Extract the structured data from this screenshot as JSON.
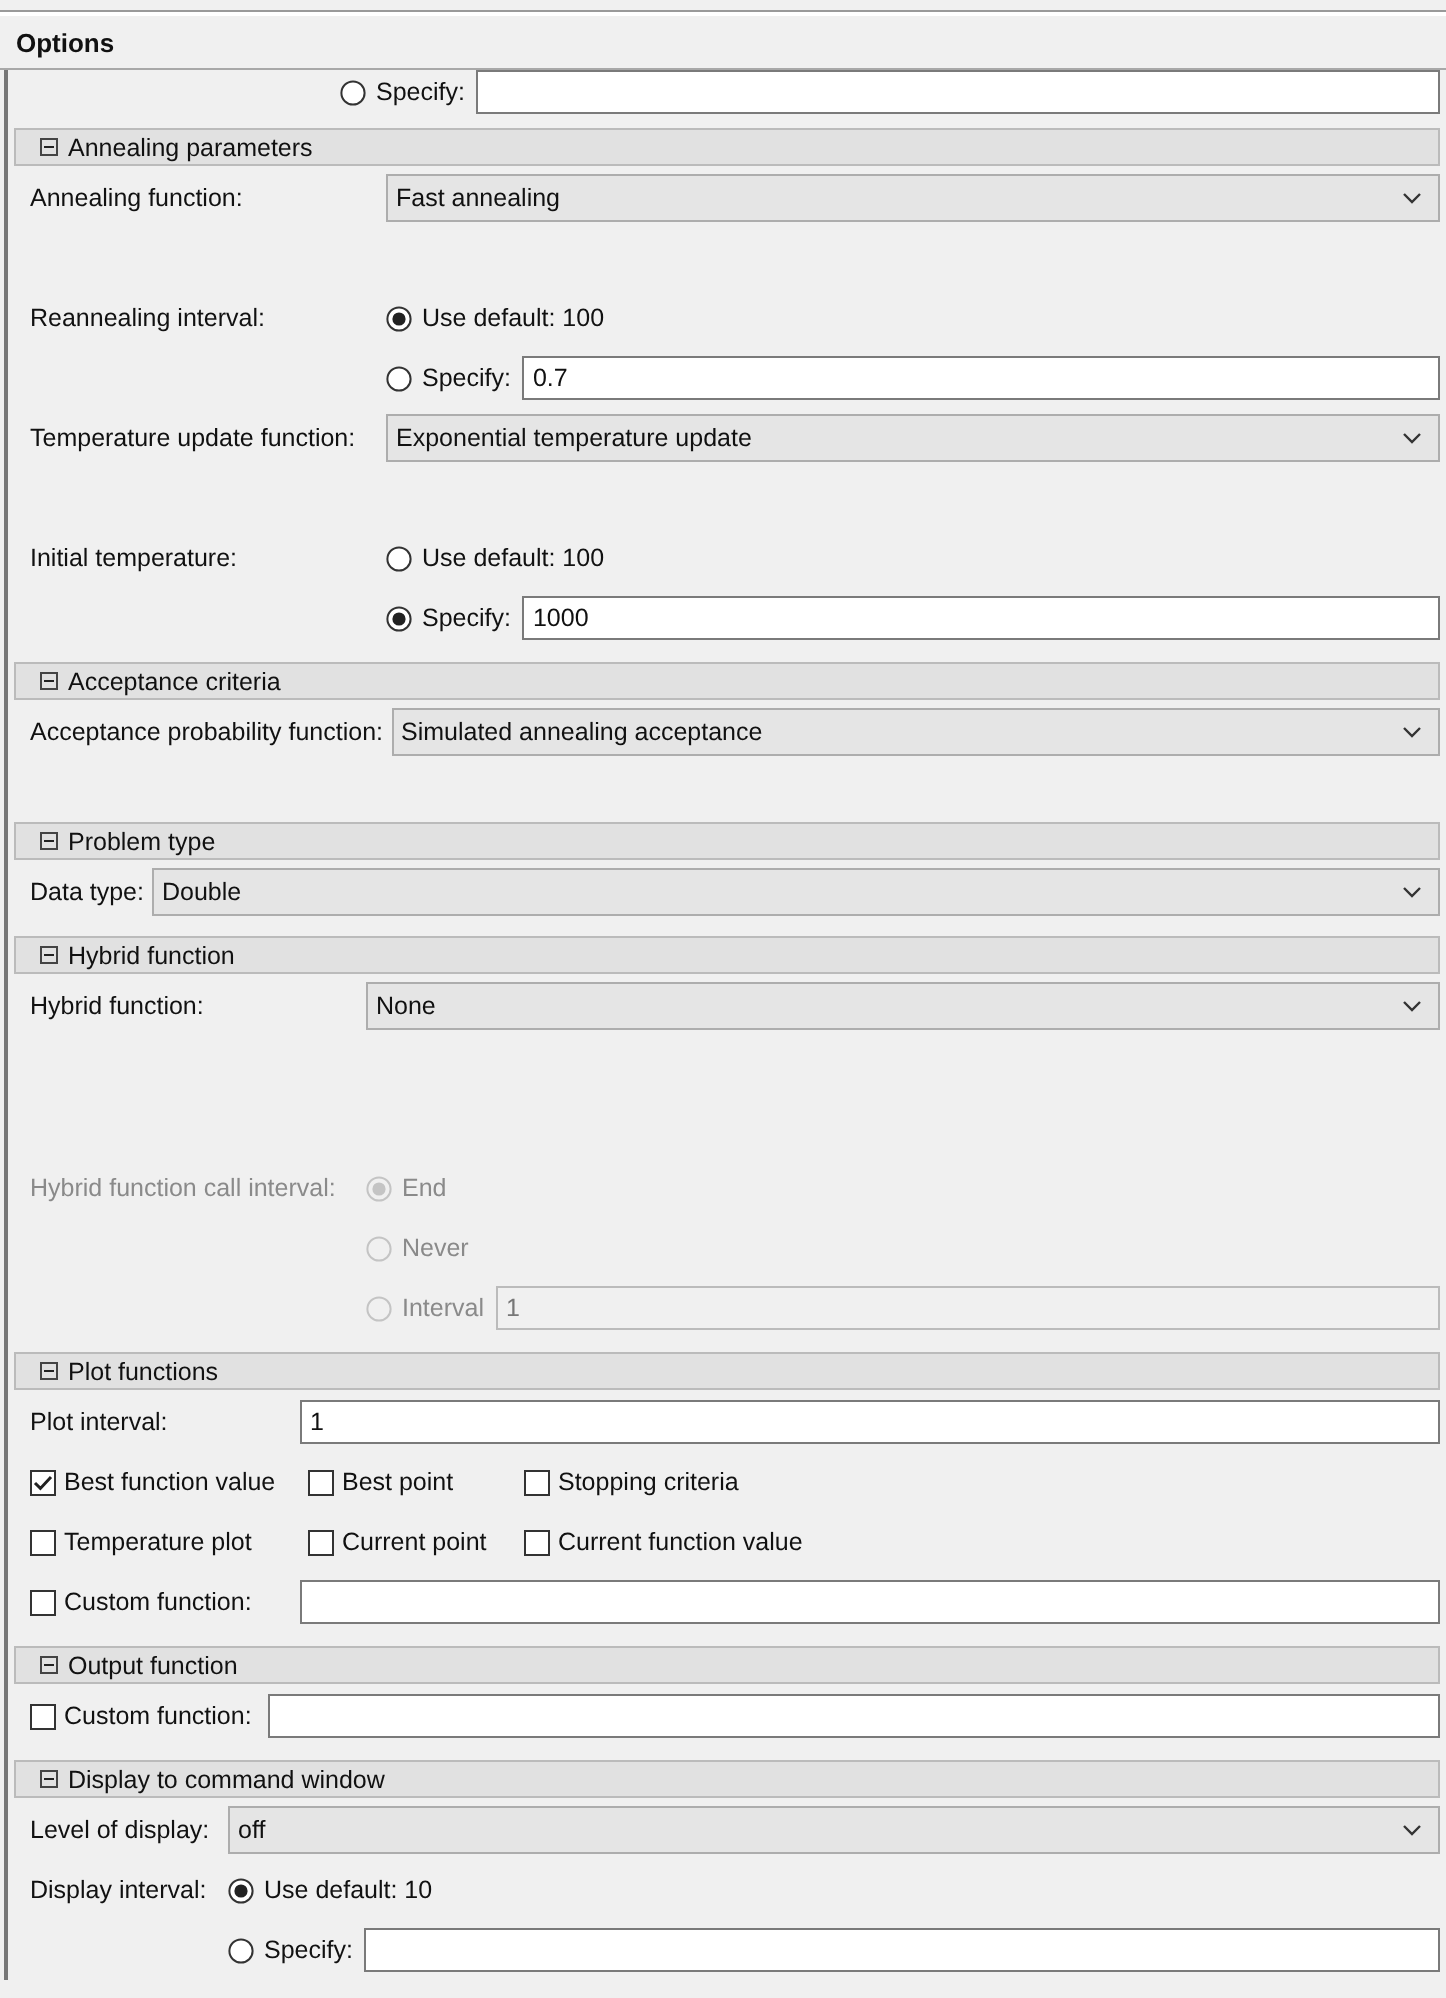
{
  "panel_title": "Options",
  "top_row": {
    "kind": "radio",
    "option": "Specify:",
    "selected": false,
    "disabled": false,
    "field": true
  },
  "sections": [
    {
      "title": "Annealing parameters",
      "expanded": true,
      "rows": [
        {
          "kind": "dropdown",
          "label": "Annealing function:",
          "value": "Fast annealing"
        },
        {
          "kind": "radio",
          "label": "Reannealing interval:",
          "option": "Use default: 100",
          "selected": true,
          "disabled": false
        },
        {
          "kind": "radio",
          "option": "Specify:",
          "selected": false,
          "disabled": false,
          "field": true,
          "value": "0.7"
        },
        {
          "kind": "dropdown",
          "label": "Temperature update function:",
          "value": "Exponential temperature update"
        },
        {
          "kind": "radio",
          "label": "Initial temperature:",
          "option": "Use default: 100",
          "selected": false,
          "disabled": false
        },
        {
          "kind": "radio",
          "option": "Specify:",
          "selected": true,
          "disabled": false,
          "field": true,
          "value": "1000"
        }
      ]
    },
    {
      "title": "Acceptance criteria",
      "expanded": true,
      "rows": [
        {
          "kind": "dropdown",
          "label": "Acceptance probability function:",
          "value": "Simulated annealing acceptance"
        }
      ]
    },
    {
      "title": "Problem type",
      "expanded": true,
      "rows": [
        {
          "kind": "dropdown",
          "label": "Data type:",
          "value": "Double"
        }
      ]
    },
    {
      "title": "Hybrid function",
      "expanded": true,
      "rows": [
        {
          "kind": "dropdown",
          "label": "Hybrid function:",
          "value": "None"
        },
        {
          "kind": "radio",
          "label": "Hybrid function call interval:",
          "option": "End",
          "selected": true,
          "disabled": true
        },
        {
          "kind": "radio",
          "option": "Never",
          "selected": false,
          "disabled": true
        },
        {
          "kind": "radio",
          "option": "Interval",
          "selected": false,
          "disabled": true,
          "field": true,
          "value": "1"
        }
      ]
    },
    {
      "title": "Plot functions",
      "expanded": true,
      "rows": [
        {
          "kind": "field",
          "label": "Plot interval:",
          "value": "1"
        },
        {
          "kind": "checks",
          "items": [
            {
              "label": "Best function value",
              "checked": true
            },
            {
              "label": "Best point",
              "checked": false
            },
            {
              "label": "Stopping criteria",
              "checked": false
            }
          ]
        },
        {
          "kind": "checks",
          "items": [
            {
              "label": "Temperature plot",
              "checked": false
            },
            {
              "label": "Current point",
              "checked": false
            },
            {
              "label": "Current function value",
              "checked": false
            }
          ]
        },
        {
          "kind": "checks",
          "items": [
            {
              "label": "Custom function:",
              "checked": false,
              "field": true
            }
          ]
        }
      ]
    },
    {
      "title": "Output function",
      "expanded": true,
      "rows": [
        {
          "kind": "checks",
          "items": [
            {
              "label": "Custom function:",
              "checked": false,
              "field": true
            }
          ]
        }
      ]
    },
    {
      "title": "Display to command window",
      "expanded": true,
      "rows": [
        {
          "kind": "dropdown",
          "label": "Level of display:",
          "value": "off"
        },
        {
          "kind": "radio",
          "label": "Display interval:",
          "option": "Use default: 10",
          "selected": true,
          "disabled": false
        },
        {
          "kind": "radio",
          "option": "Specify:",
          "selected": false,
          "disabled": false,
          "field": true
        }
      ]
    }
  ]
}
